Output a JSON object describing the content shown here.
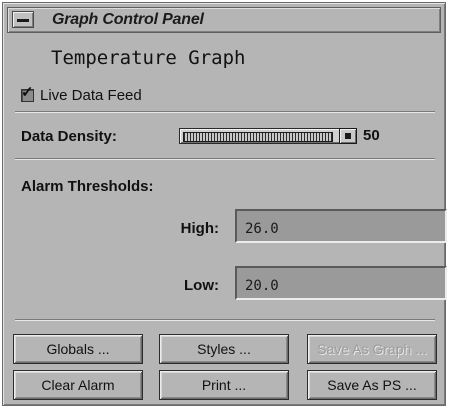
{
  "window": {
    "title": "Graph Control Panel"
  },
  "graph": {
    "title": "Temperature Graph"
  },
  "live_feed": {
    "label": "Live Data Feed",
    "checked": true
  },
  "density": {
    "label": "Data Density:",
    "value": "50",
    "slider_fraction": 0.87
  },
  "alarm": {
    "label": "Alarm Thresholds:",
    "high_label": "High:",
    "high_value": "26.0",
    "low_label": "Low:",
    "low_value": "20.0"
  },
  "buttons": {
    "globals": "Globals ...",
    "styles": "Styles ...",
    "save_as_graph": "Save As Graph ...",
    "clear_alarm": "Clear Alarm",
    "print": "Print ...",
    "save_as_ps": "Save As PS ..."
  },
  "colors": {
    "panel_bg": "#b5b5b5",
    "field_bg": "#9a9a9a",
    "disabled_text": "#9c9c9c"
  }
}
